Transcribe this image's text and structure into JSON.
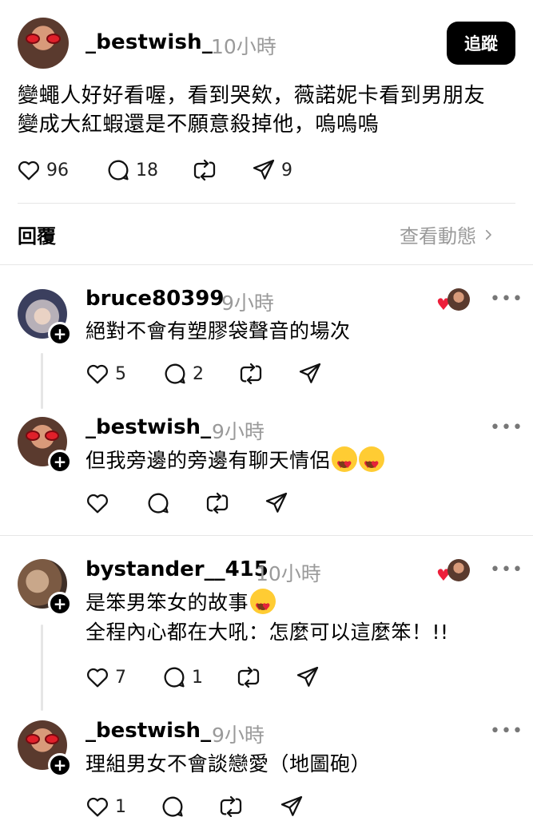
{
  "post": {
    "username": "_bestwish_",
    "time": "10小時",
    "follow_label": "追蹤",
    "text_line1": "變蠅人好好看喔，看到哭欸，薇諾妮卡看到男朋友",
    "text_line2": "變成大紅蝦還是不願意殺掉他，嗚嗚嗚",
    "likes": "96",
    "comments": "18",
    "shares": "9"
  },
  "replies_section": {
    "label": "回覆",
    "activity_link": "查看動態"
  },
  "replies": [
    {
      "username": "bruce80399",
      "time": "9小時",
      "text": "絕對不會有塑膠袋聲音的場次",
      "likes": "5",
      "comments": "2",
      "liked_by_author": true
    },
    {
      "username": "_bestwish_",
      "time": "9小時",
      "text": "但我旁邊的旁邊有聊天情侶",
      "likes": "",
      "comments": "",
      "emoji_count": 2
    },
    {
      "username": "bystander__415",
      "time": "10小時",
      "text_line1": "是笨男笨女的故事",
      "text_line2": "全程內心都在大吼：怎麼可以這麼笨！!!",
      "likes": "7",
      "comments": "1",
      "liked_by_author": true
    },
    {
      "username": "_bestwish_",
      "time": "9小時",
      "text": "理組男女不會談戀愛（地圖砲）",
      "likes": "1",
      "comments": ""
    }
  ],
  "icons": {
    "like": "heart-icon",
    "comment": "comment-icon",
    "repost": "repost-icon",
    "share": "share-icon",
    "more": "more-icon",
    "chevron": "chevron-right-icon",
    "follow": "plus-icon",
    "emoji": "heart-eyes-emoji"
  },
  "colors": {
    "accent": "#000000",
    "muted": "#9a9a9a",
    "heart": "#ed1f3b",
    "divider": "#e6e6e6"
  }
}
